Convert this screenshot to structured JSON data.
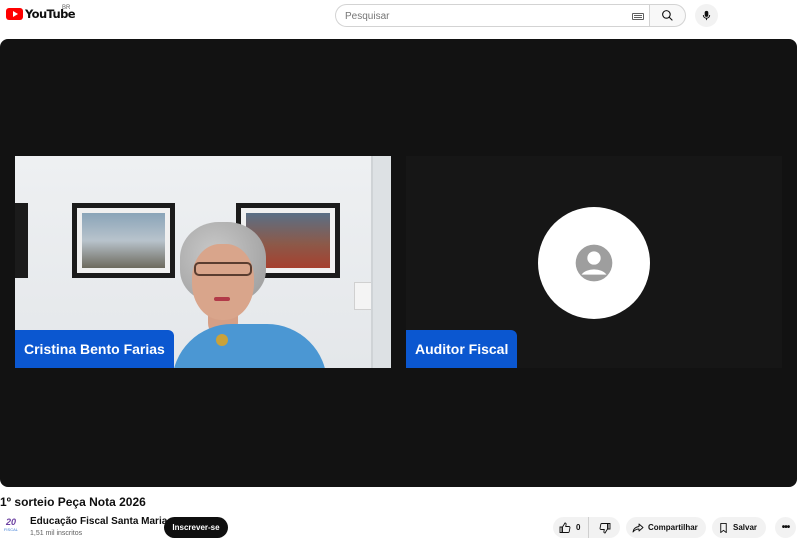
{
  "header": {
    "logo_text": "YouTube",
    "region": "BR",
    "search_placeholder": "Pesquisar",
    "icons": [
      "keyboard-icon",
      "search-icon",
      "mic-icon"
    ]
  },
  "player": {
    "participants": [
      {
        "name": "Cristina Bento Farias",
        "camera": "on"
      },
      {
        "name": "Auditor Fiscal",
        "camera": "off"
      }
    ],
    "tag_color": "#0b57d0"
  },
  "video": {
    "title": "1º sorteio Peça Nota 2026"
  },
  "channel": {
    "avatar_text": "20",
    "avatar_subtext": "FISCAL",
    "name": "Educação Fiscal Santa Maria",
    "subscribers": "1,51 mil inscritos",
    "subscribe_label": "Inscrever-se"
  },
  "actions": {
    "like_count": "0",
    "share_label": "Compartilhar",
    "save_label": "Salvar",
    "more_label": "•••"
  }
}
